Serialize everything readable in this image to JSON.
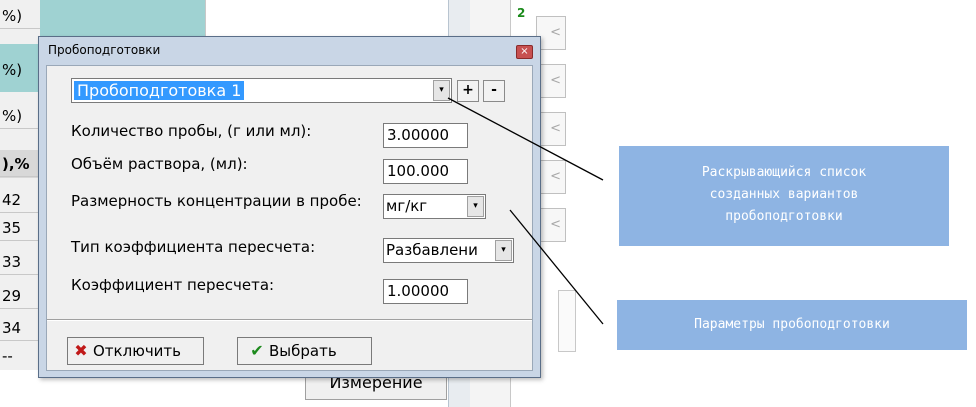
{
  "background": {
    "left_column_cells": [
      "%)",
      "%)",
      "%)",
      "),%",
      "42",
      "35",
      "33",
      "29",
      "34",
      "--"
    ],
    "green_number": "2",
    "arrow_glyph": "<",
    "measure_button": "Измерение"
  },
  "dialog": {
    "title": "Пробоподготовки",
    "close_glyph": "×",
    "preset": {
      "value": "Пробоподготовка 1",
      "add_label": "+",
      "remove_label": "-"
    },
    "dropdown_glyph": "▾",
    "fields": {
      "sample_amount_label": "Количество пробы, (г или мл):",
      "sample_amount_value": "3.00000",
      "solution_volume_label": "Объём раствора, (мл):",
      "solution_volume_value": "100.000",
      "concentration_unit_label": "Размерность концентрации в пробе:",
      "concentration_unit_value": "мг/кг",
      "coef_type_label": "Тип коэффициента пересчета:",
      "coef_type_value": "Разбавлени",
      "coef_label": "Коэффициент пересчета:",
      "coef_value": "1.00000"
    },
    "buttons": {
      "disable_label": "Отключить",
      "select_label": "Выбрать"
    }
  },
  "callouts": {
    "dropdown_lines": [
      "Раскрывающийся список",
      "созданных вариантов",
      "пробоподготовки"
    ],
    "params": "Параметры пробоподготовки"
  },
  "colors": {
    "callout_bg": "#8eb4e3",
    "selection": "#3399ff",
    "teal_header": "#9fd2d2"
  }
}
